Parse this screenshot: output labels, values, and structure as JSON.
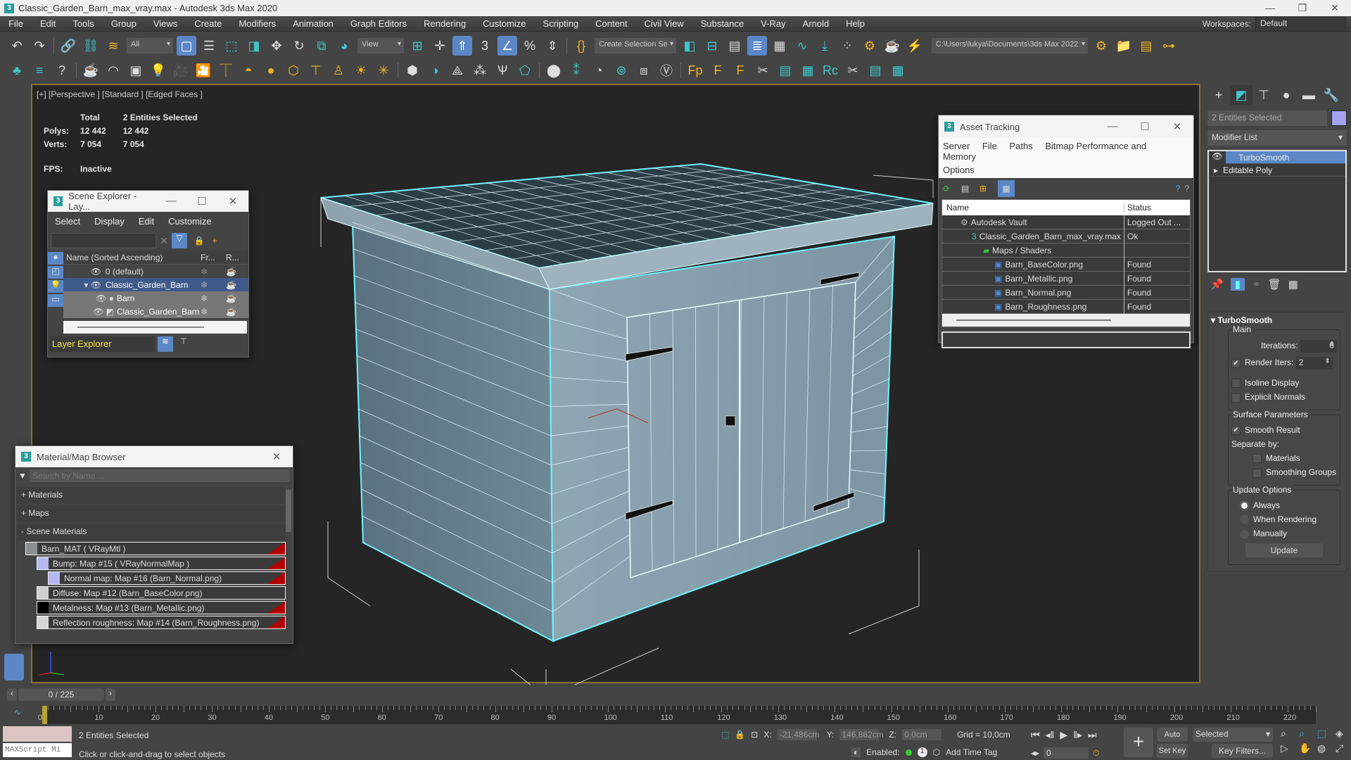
{
  "window": {
    "title": "Classic_Garden_Barn_max_vray.max - Autodesk 3ds Max 2020",
    "app_icon": "3ds-max-icon",
    "controls": {
      "minimize": "—",
      "restore": "❐",
      "close": "✕"
    }
  },
  "menubar": {
    "items": [
      "File",
      "Edit",
      "Tools",
      "Group",
      "Views",
      "Create",
      "Modifiers",
      "Animation",
      "Graph Editors",
      "Rendering",
      "Customize",
      "Scripting",
      "Content",
      "Civil View",
      "Substance",
      "V-Ray",
      "Arnold",
      "Help"
    ],
    "workspace_label": "Workspaces:",
    "workspace_value": "Default"
  },
  "toolbar_main": {
    "selection_filter": "All",
    "ref_coord": "View",
    "named_selection": "Create Selection Se",
    "project_path": "C:\\Users\\lukya\\Documents\\3ds Max 2022"
  },
  "viewport": {
    "label": "[+] [Perspective ] [Standard ] [Edged Faces ]",
    "stats": {
      "col_total": "Total",
      "col_selected": "2 Entities Selected",
      "polys_label": "Polys:",
      "polys_total": "12 442",
      "polys_selected": "12 442",
      "verts_label": "Verts:",
      "verts_total": "7 054",
      "verts_selected": "7 054",
      "fps_label": "FPS:",
      "fps_value": "Inactive"
    }
  },
  "scene_explorer": {
    "title": "Scene Explorer - Lay...",
    "menu": [
      "Select",
      "Display",
      "Edit",
      "Customize"
    ],
    "columns": {
      "name": "Name (Sorted Ascending)",
      "frozen": "Fr...",
      "render": "R..."
    },
    "rows": [
      {
        "name": "0 (default)",
        "level": 0,
        "selected": false
      },
      {
        "name": "Classic_Garden_Barn",
        "level": 0,
        "selected": true
      },
      {
        "name": "Barn",
        "level": 1,
        "selected": true
      },
      {
        "name": "Classic_Garden_Barn",
        "level": 1,
        "selected": true
      }
    ],
    "explorer_mode": "Layer Explorer"
  },
  "material_browser": {
    "title": "Material/Map Browser",
    "search_placeholder": "Search by Name ...",
    "sections": [
      "+ Materials",
      "+ Maps",
      "- Scene Materials"
    ],
    "items": [
      {
        "label": "Barn_MAT  ( VRayMtl )",
        "level": 0,
        "swatch": "#8a8f94"
      },
      {
        "label": "Bump: Map #15  ( VRayNormalMap )",
        "level": 1,
        "swatch": "#b7b7f2"
      },
      {
        "label": "Normal map: Map #16 (Barn_Normal.png)",
        "level": 2,
        "swatch": "#b7b7f2"
      },
      {
        "label": "Diffuse: Map #12 (Barn_BaseColor.png)",
        "level": 1,
        "swatch": "#cfcfcf"
      },
      {
        "label": "Metalness: Map #13 (Barn_Metallic.png)",
        "level": 1,
        "swatch": "#000000"
      },
      {
        "label": "Reflection roughness: Map #14 (Barn_Roughness.png)",
        "level": 1,
        "swatch": "#d8d8d8"
      }
    ]
  },
  "asset_tracking": {
    "title": "Asset Tracking",
    "menu": [
      "Server",
      "File",
      "Paths",
      "Bitmap Performance and Memory",
      "Options"
    ],
    "columns": {
      "name": "Name",
      "status": "Status"
    },
    "rows": [
      {
        "name": "Autodesk Vault",
        "status": "Logged Out ...",
        "level": 0,
        "icon": "vault-icon"
      },
      {
        "name": "Classic_Garden_Barn_max_vray.max",
        "status": "Ok",
        "level": 1,
        "icon": "max-file-icon"
      },
      {
        "name": "Maps / Shaders",
        "status": "",
        "level": 2,
        "icon": "maps-folder-icon"
      },
      {
        "name": "Barn_BaseColor.png",
        "status": "Found",
        "level": 3,
        "icon": "image-file-icon"
      },
      {
        "name": "Barn_Metallic.png",
        "status": "Found",
        "level": 3,
        "icon": "image-file-icon"
      },
      {
        "name": "Barn_Normal.png",
        "status": "Found",
        "level": 3,
        "icon": "image-file-icon"
      },
      {
        "name": "Barn_Roughness.png",
        "status": "Found",
        "level": 3,
        "icon": "image-file-icon"
      }
    ]
  },
  "command_panel": {
    "selection_name": "2 Entities Selected",
    "object_color": "#a3a3f0",
    "modifier_list": "Modifier List",
    "stack": [
      "TurboSmooth",
      "Editable Poly"
    ],
    "rollout_title": "TurboSmooth",
    "main_group": "Main",
    "iterations_label": "Iterations:",
    "iterations_value": "0",
    "render_iters_label": "Render Iters:",
    "render_iters_value": "2",
    "render_iters_checked": true,
    "isoline_label": "Isoline Display",
    "isoline_checked": false,
    "explicit_normals_label": "Explicit Normals",
    "explicit_normals_checked": false,
    "surface_group": "Surface Parameters",
    "smooth_result_label": "Smooth Result",
    "smooth_result_checked": true,
    "separate_by_label": "Separate by:",
    "materials_label": "Materials",
    "smoothing_groups_label": "Smoothing Groups",
    "update_group": "Update Options",
    "update_options": [
      "Always",
      "When Rendering",
      "Manually"
    ],
    "update_selected": "Always",
    "update_button": "Update"
  },
  "timeline": {
    "frame_display": "0 / 225",
    "current_frame": 0,
    "total_frames": 225,
    "ticks": [
      "0",
      "10",
      "20",
      "30",
      "40",
      "50",
      "60",
      "70",
      "80",
      "90",
      "100",
      "110",
      "120",
      "130",
      "140",
      "150",
      "160",
      "170",
      "180",
      "190",
      "200",
      "210",
      "220"
    ]
  },
  "statusbar": {
    "selection_status": "2 Entities Selected",
    "prompt": "Click or click-and-drag to select objects",
    "maxscript_placeholder": "MAXScript Mi",
    "x_label": "X:",
    "x_value": "-21,486cm",
    "y_label": "Y:",
    "y_value": "146,862cm",
    "z_label": "Z:",
    "z_value": "0,0cm",
    "grid": "Grid = 10,0cm",
    "enabled_label": "Enabled:",
    "add_time_tag": "Add Time Tag",
    "auto_key": "Auto Key",
    "set_key": "Set Key",
    "key_mode": "Selected",
    "key_filters": "Key Filters...",
    "frame_spinner": "0"
  }
}
